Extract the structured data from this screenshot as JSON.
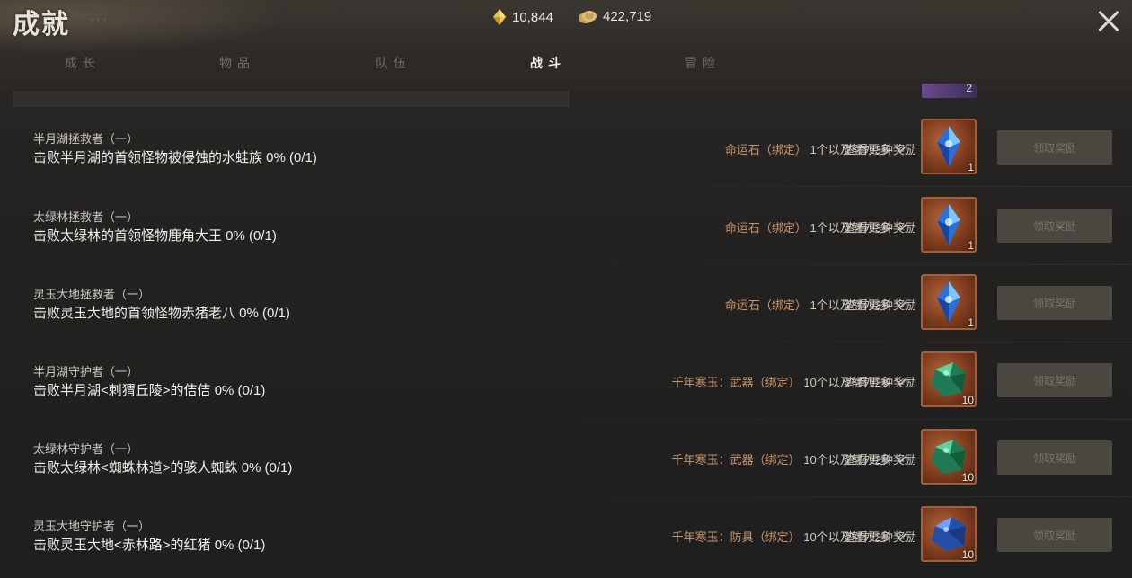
{
  "header": {
    "title": "成就",
    "currency": [
      {
        "icon": "gem-icon",
        "value": "10,844"
      },
      {
        "icon": "coin-icon",
        "value": "422,719"
      }
    ]
  },
  "tabs": [
    {
      "label": "成长",
      "active": false
    },
    {
      "label": "物品",
      "active": false
    },
    {
      "label": "队伍",
      "active": false
    },
    {
      "label": "战斗",
      "active": true
    },
    {
      "label": "冒险",
      "active": false
    }
  ],
  "top_partial_tag": "2",
  "colors": {
    "reward_item": "#c9956b",
    "icon_bg": "#7b3a1d"
  },
  "achievements": [
    {
      "name": "半月湖拯救者（一）",
      "desc": "击败半月湖的首领怪物被侵蚀的水蛙族 0% (0/1)",
      "reward_item": "命运石（绑定）",
      "reward_qty": "1个以及额外3种奖励",
      "more": "查看更多",
      "icon": "blue-crystal-icon",
      "count": "1",
      "claim": "领取奖励"
    },
    {
      "name": "太绿林拯救者（一）",
      "desc": "击败太绿林的首领怪物鹿角大王 0% (0/1)",
      "reward_item": "命运石（绑定）",
      "reward_qty": "1个以及额外3种奖励",
      "more": "查看更多",
      "icon": "blue-crystal-icon",
      "count": "1",
      "claim": "领取奖励"
    },
    {
      "name": "灵玉大地拯救者（一）",
      "desc": "击败灵玉大地的首领怪物赤猪老八 0% (0/1)",
      "reward_item": "命运石（绑定）",
      "reward_qty": "1个以及额外3种奖励",
      "more": "查看更多",
      "icon": "blue-crystal-icon",
      "count": "1",
      "claim": "领取奖励"
    },
    {
      "name": "半月湖守护者（一）",
      "desc": "击败半月湖<刺猬丘陵>的佶佶 0% (0/1)",
      "reward_item": "千年寒玉：武器（绑定）",
      "reward_qty": "10个以及额外2种奖励",
      "more": "查看更多",
      "icon": "green-jade-icon",
      "count": "10",
      "claim": "领取奖励"
    },
    {
      "name": "太绿林守护者（一）",
      "desc": "击败太绿林<蜘蛛林道>的骇人蜘蛛 0% (0/1)",
      "reward_item": "千年寒玉：武器（绑定）",
      "reward_qty": "10个以及额外2种奖励",
      "more": "查看更多",
      "icon": "green-jade-icon",
      "count": "10",
      "claim": "领取奖励"
    },
    {
      "name": "灵玉大地守护者（一）",
      "desc": "击败灵玉大地<赤林路>的红猪 0% (0/1)",
      "reward_item": "千年寒玉：防具（绑定）",
      "reward_qty": "10个以及额外2种奖励",
      "more": "查看更多",
      "icon": "blue-jade-icon",
      "count": "10",
      "claim": "领取奖励"
    }
  ]
}
